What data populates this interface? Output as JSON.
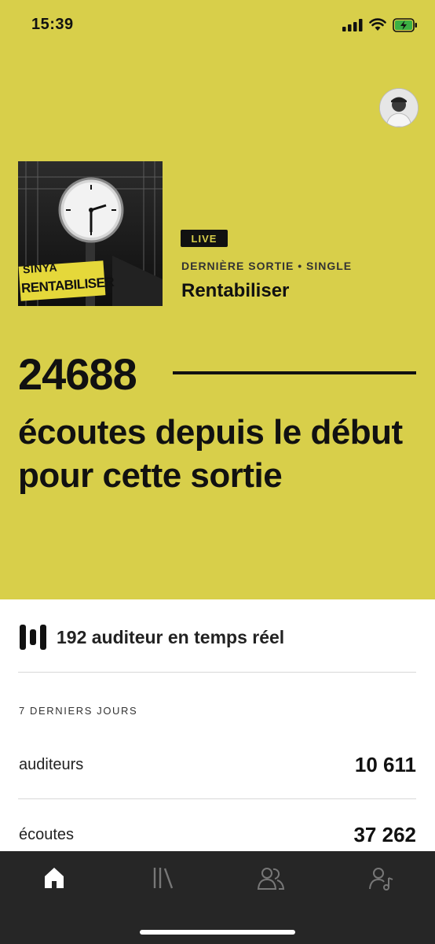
{
  "status_bar": {
    "time": "15:39"
  },
  "release": {
    "cover_artist": "SINYA",
    "cover_title": "RENTABILISER",
    "live_label": "LIVE",
    "meta": "DERNIÈRE SORTIE • SINGLE",
    "title": "Rentabiliser"
  },
  "streams": {
    "count": "24688",
    "description": "écoutes depuis le début pour cette sortie"
  },
  "realtime": {
    "text": "192 auditeur en temps réel"
  },
  "last7": {
    "label": "7 DERNIERS JOURS",
    "rows": [
      {
        "label": "auditeurs",
        "value": "10 611"
      },
      {
        "label": "écoutes",
        "value": "37 262"
      }
    ]
  },
  "tabs": [
    {
      "icon": "home-icon",
      "active": true
    },
    {
      "icon": "library-icon",
      "active": false
    },
    {
      "icon": "audience-icon",
      "active": false
    },
    {
      "icon": "artist-profile-icon",
      "active": false
    }
  ],
  "colors": {
    "accent": "#d8cf4a",
    "tabbar": "#262626",
    "ink": "#111111"
  }
}
